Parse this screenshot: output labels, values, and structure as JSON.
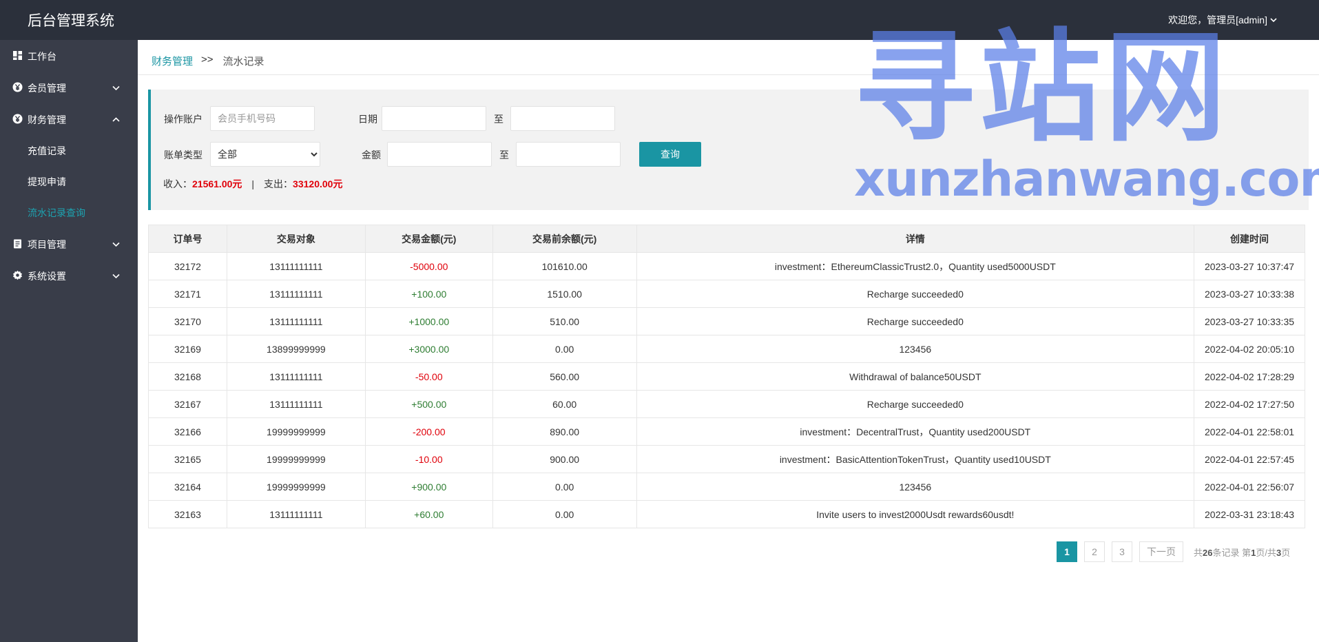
{
  "app_title": "后台管理系统",
  "user_menu_label": "欢迎您，管理员[admin]",
  "sidebar": {
    "items": [
      {
        "label": "工作台"
      },
      {
        "label": "会员管理"
      },
      {
        "label": "财务管理"
      },
      {
        "label": "项目管理"
      },
      {
        "label": "系统设置"
      }
    ],
    "finance_sub": [
      {
        "label": "充值记录"
      },
      {
        "label": "提现申请"
      },
      {
        "label": "流水记录查询"
      }
    ]
  },
  "breadcrumb": {
    "parent": "财务管理",
    "separator": ">>",
    "current": "流水记录"
  },
  "search": {
    "account_label": "操作账户",
    "account_placeholder": "会员手机号码",
    "date_label": "日期",
    "to_label": "至",
    "type_label": "账单类型",
    "type_value": "全部",
    "amount_label": "金额",
    "query_button": "查询"
  },
  "summary": {
    "income_label": "收入：",
    "income_value": "21561.00元",
    "separator": "|",
    "expense_label": "支出：",
    "expense_value": "33120.00元"
  },
  "watermark": {
    "title": "寻站网",
    "subtitle": "xunzhanwang.com"
  },
  "table": {
    "columns": [
      "订单号",
      "交易对象",
      "交易金额(元)",
      "交易前余额(元)",
      "详情",
      "创建时间"
    ],
    "rows": [
      {
        "id": "32172",
        "target": "13111111111",
        "amount": "-5000.00",
        "before": "101610.00",
        "detail": "investment：EthereumClassicTrust2.0，Quantity used5000USDT",
        "time": "2023-03-27 10:37:47"
      },
      {
        "id": "32171",
        "target": "13111111111",
        "amount": "+100.00",
        "before": "1510.00",
        "detail": "Recharge succeeded0",
        "time": "2023-03-27 10:33:38"
      },
      {
        "id": "32170",
        "target": "13111111111",
        "amount": "+1000.00",
        "before": "510.00",
        "detail": "Recharge succeeded0",
        "time": "2023-03-27 10:33:35"
      },
      {
        "id": "32169",
        "target": "13899999999",
        "amount": "+3000.00",
        "before": "0.00",
        "detail": "123456",
        "time": "2022-04-02 20:05:10"
      },
      {
        "id": "32168",
        "target": "13111111111",
        "amount": "-50.00",
        "before": "560.00",
        "detail": "Withdrawal of balance50USDT",
        "time": "2022-04-02 17:28:29"
      },
      {
        "id": "32167",
        "target": "13111111111",
        "amount": "+500.00",
        "before": "60.00",
        "detail": "Recharge succeeded0",
        "time": "2022-04-02 17:27:50"
      },
      {
        "id": "32166",
        "target": "19999999999",
        "amount": "-200.00",
        "before": "890.00",
        "detail": "investment：DecentralTrust，Quantity used200USDT",
        "time": "2022-04-01 22:58:01"
      },
      {
        "id": "32165",
        "target": "19999999999",
        "amount": "-10.00",
        "before": "900.00",
        "detail": "investment：BasicAttentionTokenTrust，Quantity used10USDT",
        "time": "2022-04-01 22:57:45"
      },
      {
        "id": "32164",
        "target": "19999999999",
        "amount": "+900.00",
        "before": "0.00",
        "detail": "123456",
        "time": "2022-04-01 22:56:07"
      },
      {
        "id": "32163",
        "target": "13111111111",
        "amount": "+60.00",
        "before": "0.00",
        "detail": "Invite users to invest2000Usdt rewards60usdt!",
        "time": "2022-03-31 23:18:43"
      }
    ]
  },
  "pagination": {
    "pages": [
      "1",
      "2",
      "3"
    ],
    "next_label": "下一页",
    "info_prefix": "共",
    "total": "26",
    "info_mid": "条记录 第",
    "current": "1",
    "info_mid2": "页/共",
    "total_pages": "3",
    "info_suffix": "页"
  },
  "colors": {
    "accent": "#1a95a3",
    "negative": "#e0000a",
    "positive": "#2e7d32",
    "sidebar_bg": "#393d49",
    "topbar_bg": "#2b303b"
  }
}
